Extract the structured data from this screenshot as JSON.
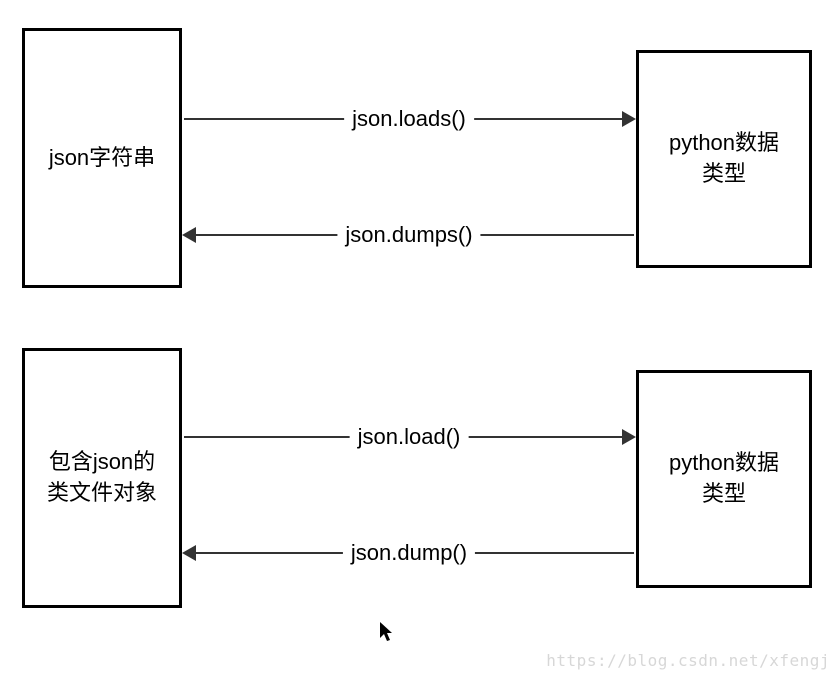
{
  "diagram1": {
    "left_box": "json字符串",
    "right_box": "python数据\n类型",
    "top_arrow": "json.loads()",
    "bottom_arrow": "json.dumps()"
  },
  "diagram2": {
    "left_box": "包含json的\n类文件对象",
    "right_box": "python数据\n类型",
    "top_arrow": "json.load()",
    "bottom_arrow": "json.dump()"
  },
  "watermark": "https://blog.csdn.net/xfengj",
  "chart_data": {
    "type": "diagram",
    "description": "Two flow diagrams showing JSON serialization/deserialization in Python",
    "diagrams": [
      {
        "left_node": "json字符串",
        "right_node": "python数据类型",
        "edges": [
          {
            "from": "json字符串",
            "to": "python数据类型",
            "label": "json.loads()"
          },
          {
            "from": "python数据类型",
            "to": "json字符串",
            "label": "json.dumps()"
          }
        ]
      },
      {
        "left_node": "包含json的类文件对象",
        "right_node": "python数据类型",
        "edges": [
          {
            "from": "包含json的类文件对象",
            "to": "python数据类型",
            "label": "json.load()"
          },
          {
            "from": "python数据类型",
            "to": "包含json的类文件对象",
            "label": "json.dump()"
          }
        ]
      }
    ]
  }
}
